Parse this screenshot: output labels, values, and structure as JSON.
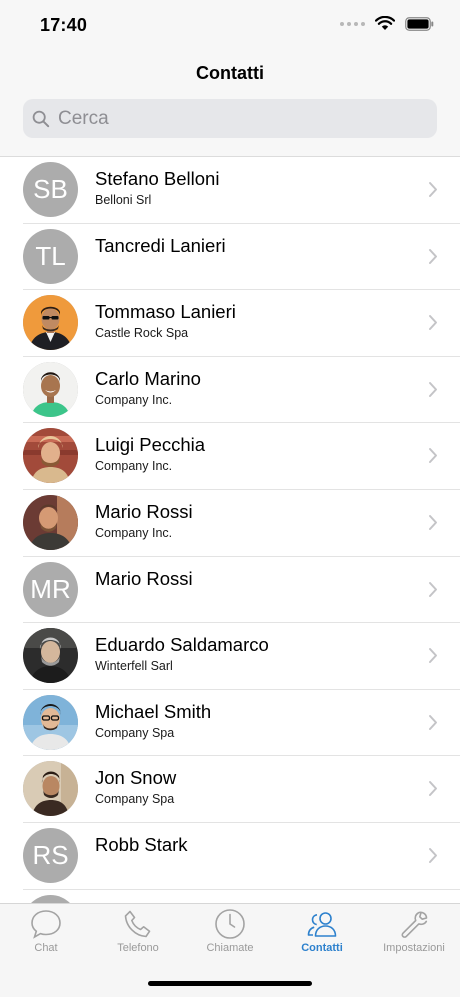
{
  "status_bar": {
    "time": "17:40"
  },
  "header": {
    "title": "Contatti"
  },
  "search": {
    "placeholder": "Cerca"
  },
  "contacts": [
    {
      "initials": "SB",
      "name": "Stefano Belloni",
      "company": "Belloni Srl",
      "avatar": "initials"
    },
    {
      "initials": "TL",
      "name": "Tancredi Lanieri",
      "company": "",
      "avatar": "initials"
    },
    {
      "initials": "",
      "name": "Tommaso Lanieri",
      "company": "Castle Rock Spa",
      "avatar": "photo"
    },
    {
      "initials": "",
      "name": "Carlo Marino",
      "company": "Company Inc.",
      "avatar": "photo"
    },
    {
      "initials": "",
      "name": "Luigi Pecchia",
      "company": "Company Inc.",
      "avatar": "photo"
    },
    {
      "initials": "",
      "name": "Mario Rossi",
      "company": "Company Inc.",
      "avatar": "photo"
    },
    {
      "initials": "MR",
      "name": "Mario Rossi",
      "company": "",
      "avatar": "initials"
    },
    {
      "initials": "",
      "name": "Eduardo Saldamarco",
      "company": "Winterfell Sarl",
      "avatar": "photo"
    },
    {
      "initials": "",
      "name": "Michael Smith",
      "company": "Company Spa",
      "avatar": "photo"
    },
    {
      "initials": "",
      "name": "Jon Snow",
      "company": "Company Spa",
      "avatar": "photo"
    },
    {
      "initials": "RS",
      "name": "Robb Stark",
      "company": "",
      "avatar": "initials"
    }
  ],
  "tabs": [
    {
      "label": "Chat",
      "icon": "chat-bubble-icon",
      "active": false
    },
    {
      "label": "Telefono",
      "icon": "phone-icon",
      "active": false
    },
    {
      "label": "Chiamate",
      "icon": "clock-icon",
      "active": false
    },
    {
      "label": "Contatti",
      "icon": "contacts-icon",
      "active": true
    },
    {
      "label": "Impostazioni",
      "icon": "wrench-icon",
      "active": false
    }
  ],
  "colors": {
    "accent": "#2d81cd",
    "avatar_placeholder": "#acacac",
    "inactive_tab": "#9a9a9a",
    "search_field": "#e6e7ea"
  }
}
